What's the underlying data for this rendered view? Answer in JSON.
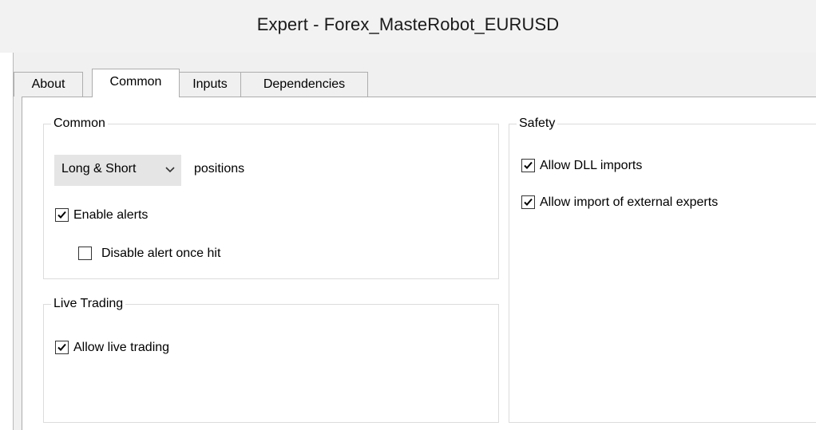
{
  "window": {
    "title": "Expert - Forex_MasteRobot_EURUSD"
  },
  "tabs": [
    {
      "label": "About",
      "active": false
    },
    {
      "label": "Common",
      "active": true
    },
    {
      "label": "Inputs",
      "active": false
    },
    {
      "label": "Dependencies",
      "active": false
    }
  ],
  "common": {
    "legend": "Common",
    "positions_select": {
      "value": "Long & Short"
    },
    "positions_label": "positions",
    "enable_alerts": {
      "label": "Enable alerts",
      "checked": true
    },
    "disable_alert_once_hit": {
      "label": "Disable alert once hit",
      "checked": false
    }
  },
  "live_trading": {
    "legend": "Live Trading",
    "allow_live_trading": {
      "label": "Allow live trading",
      "checked": true
    }
  },
  "safety": {
    "legend": "Safety",
    "allow_dll_imports": {
      "label": "Allow DLL imports",
      "checked": true
    },
    "allow_import_external_experts": {
      "label": "Allow import of external experts",
      "checked": true
    }
  }
}
